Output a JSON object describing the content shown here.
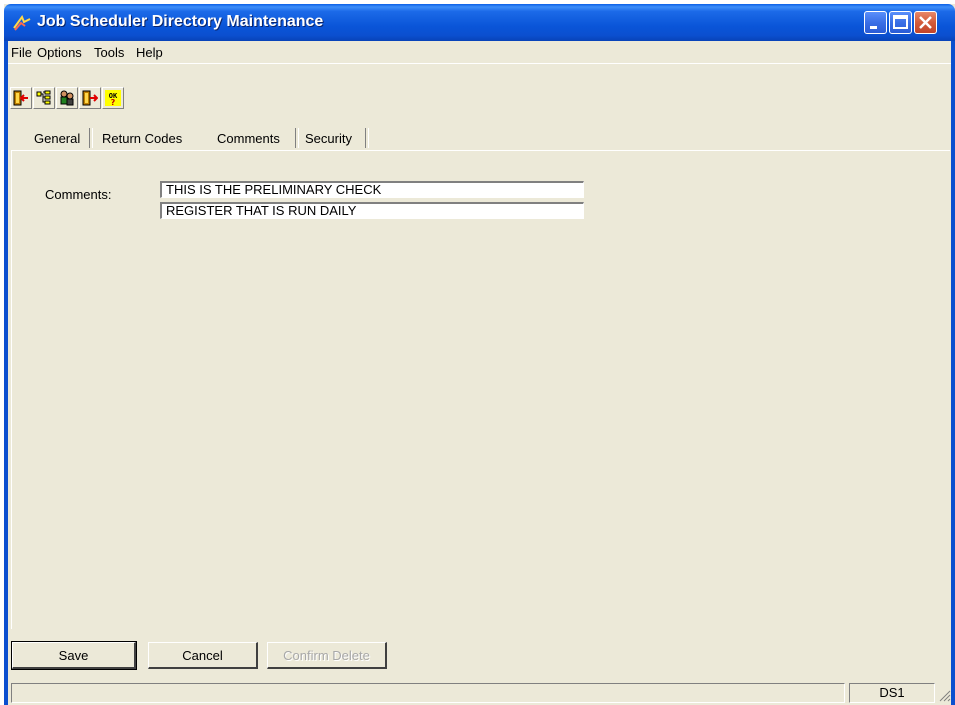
{
  "window": {
    "title": "Job Scheduler Directory Maintenance"
  },
  "menu": {
    "file": "File",
    "options": "Options",
    "tools": "Tools",
    "help": "Help"
  },
  "toolbar": {
    "icons": [
      "exit-left-icon",
      "tree-icon",
      "users-icon",
      "exit-right-icon",
      "ok-help-icon"
    ],
    "ok_text": "OK"
  },
  "tabs": [
    {
      "label": "General",
      "active": false
    },
    {
      "label": "Return Codes",
      "active": false
    },
    {
      "label": "Comments",
      "active": true
    },
    {
      "label": "Security",
      "active": false
    }
  ],
  "comments": {
    "label": "Comments:",
    "lines": [
      "THIS IS THE PRELIMINARY CHECK",
      "REGISTER THAT IS RUN DAILY"
    ]
  },
  "buttons": {
    "save": "Save",
    "cancel": "Cancel",
    "confirm_delete": "Confirm Delete"
  },
  "status": {
    "main": "",
    "database": "DS1"
  },
  "colors": {
    "titlebar": "#0b4fcf",
    "face": "#ece9d8",
    "close": "#d35b3a"
  }
}
